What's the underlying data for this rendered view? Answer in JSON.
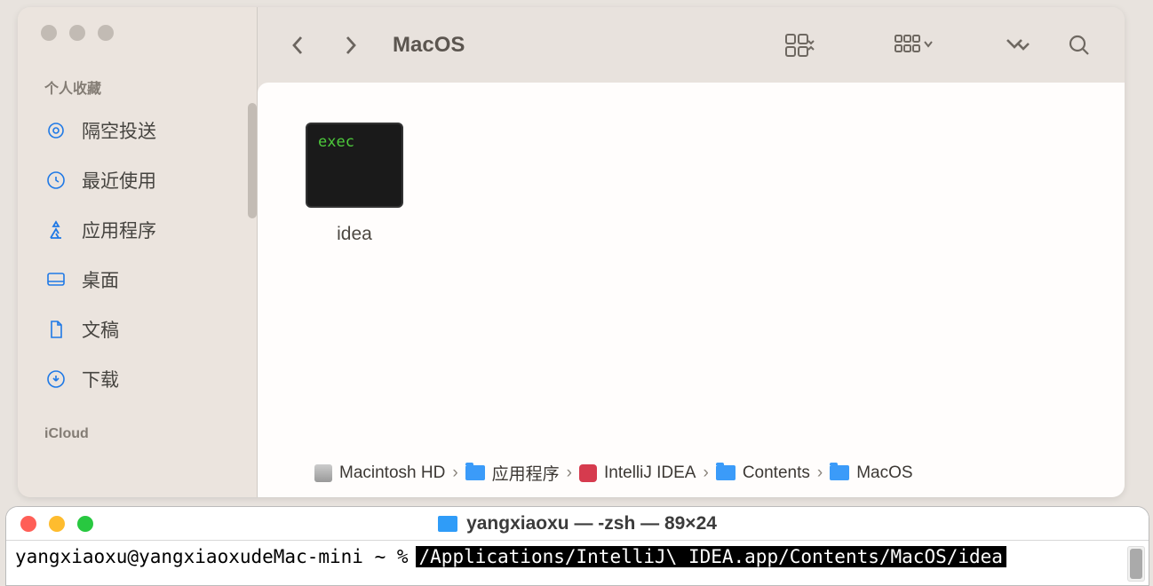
{
  "finder": {
    "title": "MacOS",
    "sidebar": {
      "favorites_title": "个人收藏",
      "icloud_title": "iCloud",
      "items": [
        {
          "label": "隔空投送",
          "icon": "airdrop"
        },
        {
          "label": "最近使用",
          "icon": "clock"
        },
        {
          "label": "应用程序",
          "icon": "apps"
        },
        {
          "label": "桌面",
          "icon": "desktop"
        },
        {
          "label": "文稿",
          "icon": "doc"
        },
        {
          "label": "下载",
          "icon": "download"
        }
      ]
    },
    "file": {
      "name": "idea",
      "exec_badge": "exec"
    },
    "pathbar": [
      {
        "label": "Macintosh HD",
        "icon": "disk"
      },
      {
        "label": "应用程序",
        "icon": "folder"
      },
      {
        "label": "IntelliJ IDEA",
        "icon": "app"
      },
      {
        "label": "Contents",
        "icon": "folder"
      },
      {
        "label": "MacOS",
        "icon": "folder"
      }
    ]
  },
  "terminal": {
    "title": "yangxiaoxu — -zsh — 89×24",
    "prompt": "yangxiaoxu@yangxiaoxudeMac-mini ~ %",
    "command": "/Applications/IntelliJ\\ IDEA.app/Contents/MacOS/idea "
  }
}
